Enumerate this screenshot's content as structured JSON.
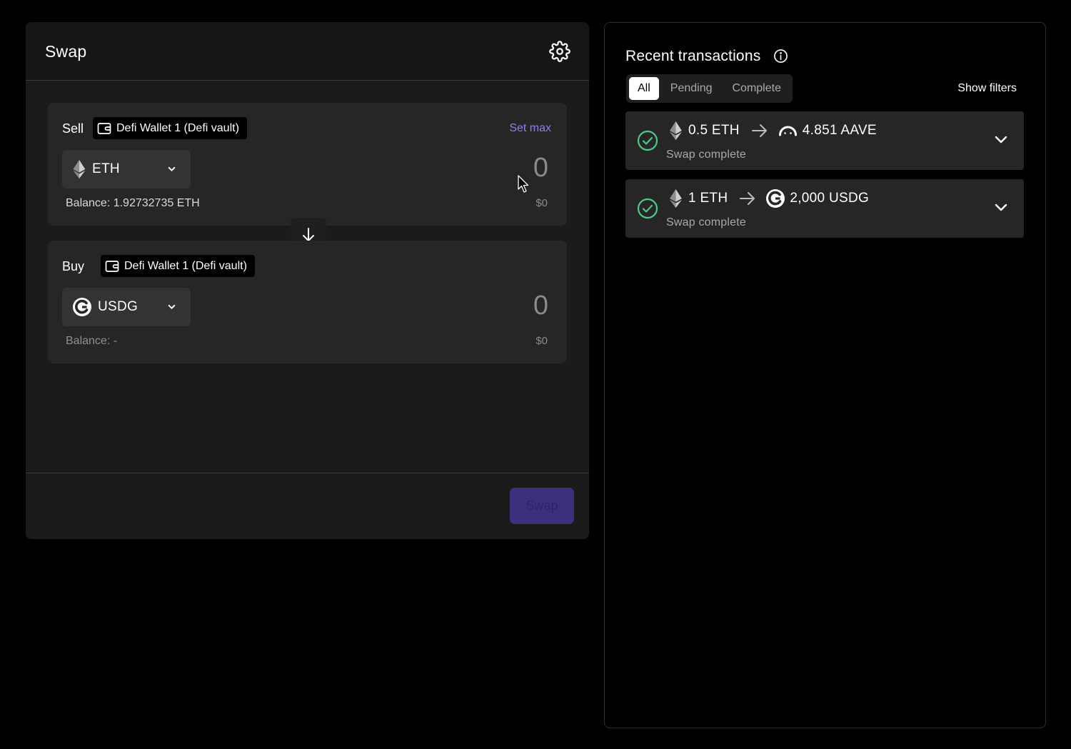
{
  "swap": {
    "title": "Swap",
    "sell": {
      "label": "Sell",
      "wallet": "Defi Wallet 1 (Defi vault)",
      "set_max": "Set max",
      "token": "ETH",
      "amount": "0",
      "usd": "$0",
      "balance": "Balance: 1.92732735 ETH"
    },
    "buy": {
      "label": "Buy",
      "wallet": "Defi Wallet 1 (Defi vault)",
      "token": "USDG",
      "amount": "0",
      "usd": "$0",
      "balance": "Balance: -"
    },
    "swap_button": "Swap"
  },
  "transactions": {
    "title": "Recent transactions",
    "tabs": [
      "All",
      "Pending",
      "Complete"
    ],
    "active_tab": "All",
    "show_filters": "Show filters",
    "items": [
      {
        "from": "0.5 ETH",
        "to": "4.851 AAVE",
        "to_icon": "aave-icon",
        "status": "Swap complete"
      },
      {
        "from": "1 ETH",
        "to": "2,000 USDG",
        "to_icon": "usdg-icon",
        "status": "Swap complete"
      }
    ]
  },
  "colors": {
    "accent": "#8f7df0",
    "success": "#4cc987",
    "swap_button_disabled": "#3c2f7d"
  }
}
